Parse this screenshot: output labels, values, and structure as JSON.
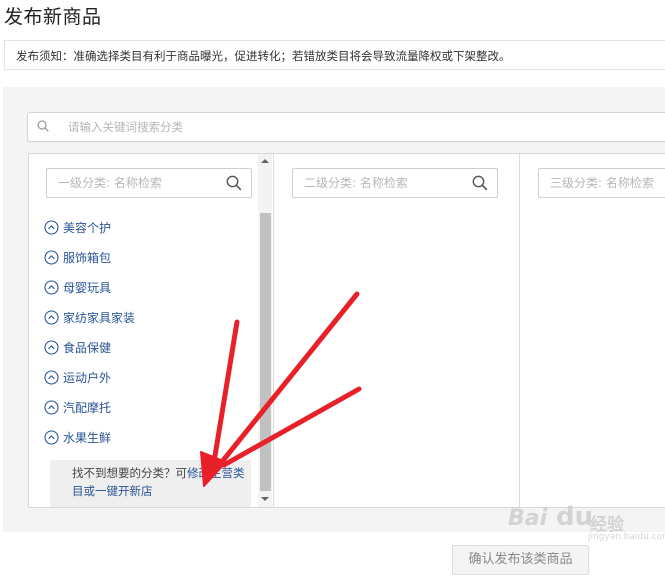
{
  "page": {
    "title": "发布新商品",
    "notice": "发布须知：准确选择类目有利于商品曝光，促进转化；若错放类目将会导致流量降权或下架整改。"
  },
  "search": {
    "placeholder": "请输入关键词搜索分类",
    "icon": "search-icon"
  },
  "columns": [
    {
      "placeholder": "一级分类: 名称检索"
    },
    {
      "placeholder": "二级分类: 名称检索"
    },
    {
      "placeholder": "三级分类: 名称检索"
    }
  ],
  "categories": [
    {
      "label": "美容个护"
    },
    {
      "label": "服饰箱包"
    },
    {
      "label": "母婴玩具"
    },
    {
      "label": "家纺家具家装"
    },
    {
      "label": "食品保健"
    },
    {
      "label": "运动户外"
    },
    {
      "label": "汽配摩托"
    },
    {
      "label": "水果生鲜"
    }
  ],
  "help": {
    "text": "找不到想要的分类？可",
    "link": "修改主营类目或一键开新店"
  },
  "actions": {
    "confirm_label": "确认发布该类商品"
  },
  "watermark": {
    "brand_part1": "Bai",
    "brand_paw": "du",
    "brand_cn": "经验",
    "domain": "jingyan.baidu.com"
  },
  "colors": {
    "link": "#2a5496",
    "annotation_arrow": "#e8202a",
    "panel_bg": "#f4f4f4"
  }
}
